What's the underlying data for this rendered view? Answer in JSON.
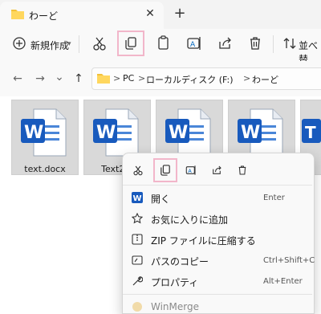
{
  "window": {
    "tab_title": "わーど",
    "close_glyph": "✕",
    "newtab_glyph": "+"
  },
  "commandbar": {
    "new_label": "新規作成",
    "sort_label": "並べ替",
    "icons": [
      "plus-icon",
      "cut-icon",
      "copy-icon",
      "paste-icon",
      "rename-icon",
      "share-icon",
      "delete-icon",
      "sort-icon"
    ]
  },
  "nav": {
    "back": "←",
    "forward": "→",
    "recent": "⌄",
    "up": "↑"
  },
  "breadcrumb": {
    "items": [
      "PC",
      "ローカルディスク (F:)",
      "わーど"
    ],
    "separator": ">"
  },
  "files": [
    {
      "name": "text.docx"
    },
    {
      "name": "Text2.d"
    },
    {
      "name": ""
    },
    {
      "name": ""
    },
    {
      "name": ""
    }
  ],
  "context_menu": {
    "quick_actions": [
      "cut-icon",
      "copy-icon",
      "rename-icon",
      "share-icon",
      "delete-icon"
    ],
    "items": [
      {
        "label": "開く",
        "shortcut": "Enter",
        "icon": "word-icon"
      },
      {
        "label": "お気に入りに追加",
        "shortcut": "",
        "icon": "star-icon"
      },
      {
        "label": "ZIP ファイルに圧縮する",
        "shortcut": "",
        "icon": "zip-icon"
      },
      {
        "label": "パスのコピー",
        "shortcut": "Ctrl+Shift+C",
        "icon": "path-copy-icon"
      },
      {
        "label": "プロパティ",
        "shortcut": "Alt+Enter",
        "icon": "wrench-icon"
      },
      {
        "label": "WinMerge",
        "shortcut": "",
        "icon": "winmerge-icon"
      }
    ]
  },
  "colors": {
    "highlight": "#f2b6ca",
    "word_blue": "#185abd",
    "accent": "#0067c0"
  }
}
